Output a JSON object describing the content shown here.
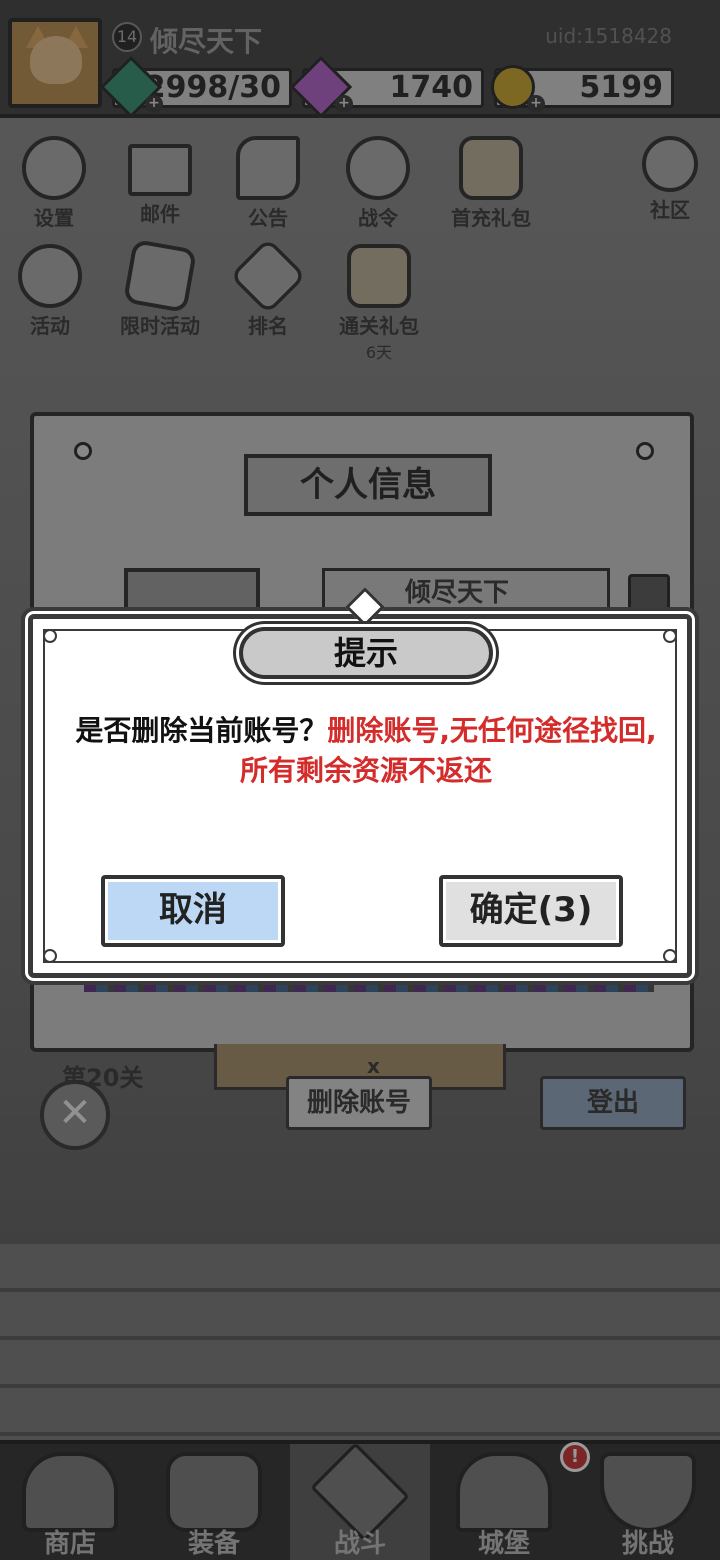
{
  "player": {
    "level": "14",
    "name": "倾尽天下",
    "uid": "uid:1518428"
  },
  "resources": [
    {
      "name": "energy",
      "value": "2998/30",
      "icon": "green-gem-icon",
      "color": "#2f8f6e"
    },
    {
      "name": "diamond",
      "value": "1740",
      "icon": "purple-diamond-icon",
      "color": "#b05dc8"
    },
    {
      "name": "gold",
      "value": "5199",
      "icon": "gold-coin-icon",
      "color": "#c9a227"
    }
  ],
  "menu": {
    "row1": [
      {
        "label": "设置",
        "icon": "gear-icon"
      },
      {
        "label": "邮件",
        "icon": "mail-icon"
      },
      {
        "label": "公告",
        "icon": "scroll-icon"
      },
      {
        "label": "战令",
        "icon": "medal-icon"
      },
      {
        "label": "首充礼包",
        "icon": "gift-bag-icon"
      }
    ],
    "community": {
      "label": "社区",
      "icon": "home-icon"
    },
    "row2": [
      {
        "label": "活动",
        "icon": "laurel-icon"
      },
      {
        "label": "限时活动",
        "icon": "hourglass-icon"
      },
      {
        "label": "排名",
        "icon": "podium-icon"
      },
      {
        "label": "通关礼包",
        "sub": "6天",
        "icon": "gift-bag-icon"
      }
    ]
  },
  "profile_panel": {
    "title": "个人信息",
    "name": "倾尽天下",
    "stage": "第20关",
    "gem_multiplier": "x",
    "delete_account_label": "删除账号",
    "logout_label": "登出"
  },
  "dialog": {
    "title": "提示",
    "question": "是否删除当前账号？",
    "warning": "删除账号,无任何途径找回,所有剩余资源不返还",
    "cancel_label": "取消",
    "confirm_label": "确定(3)"
  },
  "bottom_nav": [
    {
      "label": "商店",
      "icon": "shop-icon"
    },
    {
      "label": "装备",
      "icon": "backpack-icon"
    },
    {
      "label": "战斗",
      "icon": "crossed-swords-icon",
      "active": true
    },
    {
      "label": "城堡",
      "icon": "castle-icon"
    },
    {
      "label": "挑战",
      "icon": "shield-icon"
    }
  ],
  "castle_badge": "!"
}
